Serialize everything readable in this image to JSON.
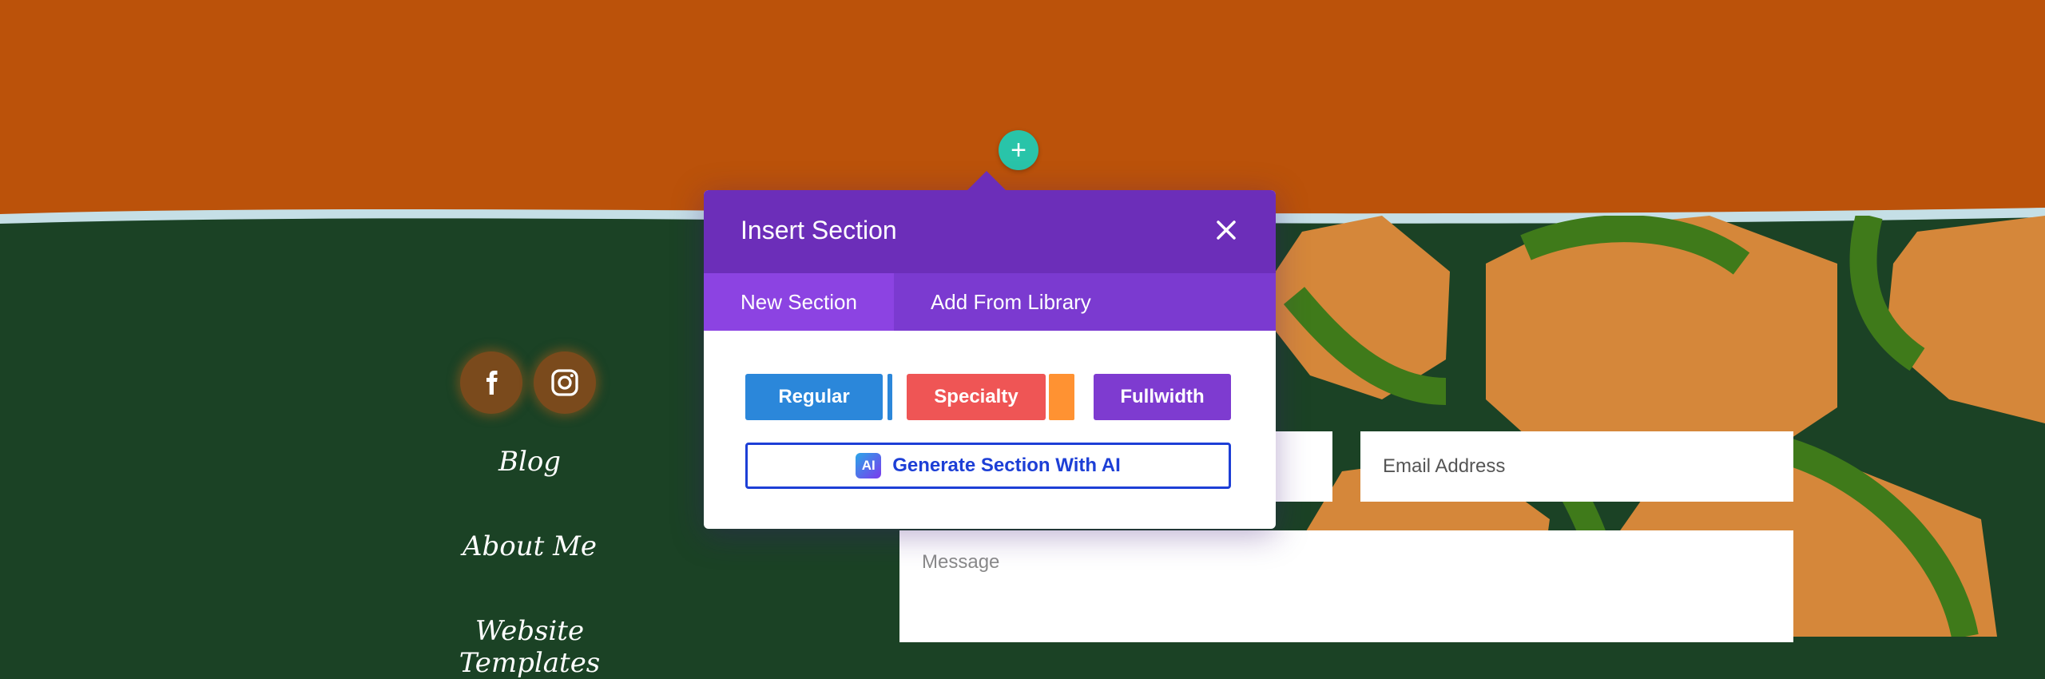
{
  "footer": {
    "social": [
      {
        "name": "facebook",
        "icon": "facebook-icon"
      },
      {
        "name": "instagram",
        "icon": "instagram-icon"
      }
    ],
    "links": [
      "Blog",
      "About Me",
      "Website Templates"
    ]
  },
  "form": {
    "email_placeholder": "Email Address",
    "message_placeholder": "Message"
  },
  "add_section_symbol": "+",
  "modal": {
    "title": "Insert Section",
    "close_icon": "close-icon",
    "tabs": [
      {
        "label": "New Section",
        "active": true
      },
      {
        "label": "Add From Library",
        "active": false
      }
    ],
    "buttons": {
      "regular": "Regular",
      "specialty": "Specialty",
      "fullwidth": "Fullwidth",
      "ai": "Generate Section With AI",
      "ai_badge": "AI"
    }
  },
  "colors": {
    "top_band": "#bb520a",
    "footer_bg": "#1b4225",
    "modal_header": "#6c2eb9",
    "tab_bar": "#7b3ad0",
    "active_tab": "#8c43e2",
    "regular": "#2b87da",
    "specialty": "#ef5555",
    "specialty_accent": "#ff9232",
    "fullwidth": "#7e3bd0",
    "ai_border": "#1d3fd6",
    "add_button": "#29c4a9"
  }
}
